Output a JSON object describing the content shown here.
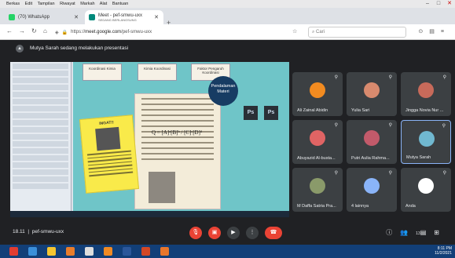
{
  "menubar": {
    "items": [
      "Berkas",
      "Edit",
      "Tampilan",
      "Riwayat",
      "Markah",
      "Alat",
      "Bantuan"
    ]
  },
  "tabs": [
    {
      "label": "(70) WhatsApp"
    },
    {
      "label": "Meet - pef-smwu-uxx",
      "sub": "SEDANG BERLANGSUNG"
    }
  ],
  "address_bar": {
    "url_host": "meet.google.com",
    "url_path": "/pef-smwu-uxx",
    "url_scheme": "https://",
    "search_placeholder": "Cari"
  },
  "presenting_banner": "Mutya Sarah sedang melakukan presentasi",
  "slide": {
    "folders": [
      "Koordinasi Kimia",
      "Kimia Koordinasi",
      "Faktor Pengaruh Koordinasi"
    ],
    "badge": "Pendalaman Materi",
    "sticky_title": "INGAT!!",
    "formula": "Q = [A]ᵃ[B]ᵇ / [C]ᶜ[D]ᵈ",
    "ps_labels": [
      "Ps",
      "Ps"
    ]
  },
  "participants": [
    {
      "name": "Ali Zainal Abidin",
      "avatar": "#f28b20"
    },
    {
      "name": "Yulia Sari",
      "avatar": "#d88a6e"
    },
    {
      "name": "Jingga Novia Nur ...",
      "avatar": "#c76a5a"
    },
    {
      "name": "Abuyazid Al-busta...",
      "avatar": "#e06464"
    },
    {
      "name": "Putri Aulia Rahma...",
      "avatar": "#c25a6a"
    },
    {
      "name": "Mutya Sarah",
      "avatar": "#70b8d0"
    },
    {
      "name": "M Daffa Satria Pra...",
      "avatar": "#8a9a6a"
    },
    {
      "name": "4 lainnya",
      "avatar": "#8ab4f8"
    },
    {
      "name": "Anda",
      "avatar": "#ffffff"
    }
  ],
  "meeting": {
    "time": "18.11",
    "code": "pef-smwu-uxx",
    "people_count": "13"
  },
  "clock": {
    "time": "8:11 PM",
    "date": "11/2/2021"
  },
  "colors": {
    "accent": "#8ab4f8",
    "hangup": "#ea4335",
    "taskbar": "#123f78"
  }
}
